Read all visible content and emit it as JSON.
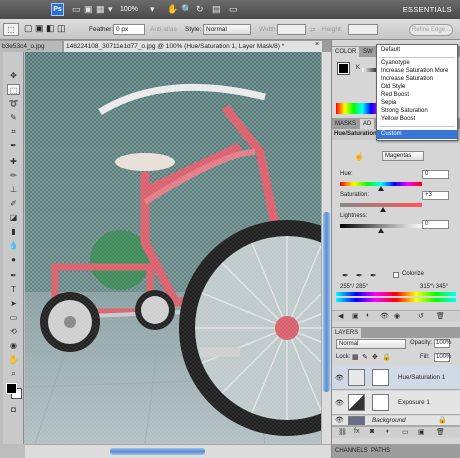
{
  "app_bar": {
    "logo": "Ps",
    "zoom": "100%",
    "workspace": "ESSENTIALS",
    "icons": [
      "bridge-icon",
      "mini-bridge-icon",
      "hand-icon",
      "zoom-icon",
      "rotate-view-icon",
      "arrange-documents-icon",
      "screen-mode-icon"
    ]
  },
  "options_bar": {
    "feather_label": "Feather:",
    "feather_value": "0 px",
    "anti_alias_label": "Anti-alias",
    "style_label": "Style:",
    "style_value": "Normal",
    "width_label": "Width:",
    "height_label": "Height:",
    "refine_edge": "Refine Edge..."
  },
  "document_tabs": [
    {
      "label": "b3e53c4_o.jpg"
    },
    {
      "label": "148224108_30711e1d77_o.jpg @ 100% (Hue/Saturation 1, Layer Mask/8) *"
    }
  ],
  "dock": {
    "top_tabs": [
      "COLOR",
      "SW"
    ],
    "color_k_label": "K",
    "mid_tabs": [
      "MASKS",
      "AD"
    ],
    "adjustment_title": "Hue/Saturation"
  },
  "preset_menu": {
    "items": [
      "Default",
      "Cyanotype",
      "Increase Saturation More",
      "Increase Saturation",
      "Old Style",
      "Red Boost",
      "Sepia",
      "Strong Saturation",
      "Yellow Boost",
      "Custom"
    ],
    "selected": "Custom"
  },
  "adjustments": {
    "channel": "Magentas",
    "hue_label": "Hue:",
    "hue_value": "0",
    "saturation_label": "Saturation:",
    "saturation_value": "+3",
    "lightness_label": "Lightness:",
    "lightness_value": "0",
    "colorize_label": "Colorize",
    "range_left": "255°/ 285°",
    "range_right": "315°\\ 345°"
  },
  "layers": {
    "tab_label": "LAYERS",
    "blend_mode": "Normal",
    "opacity_label": "Opacity:",
    "opacity_value": "100%",
    "lock_label": "Lock:",
    "fill_label": "Fill:",
    "fill_value": "100%",
    "items": [
      {
        "name": "Hue/Saturation 1",
        "visible": true,
        "selected": true
      },
      {
        "name": "Exposure 1",
        "visible": true,
        "selected": false
      },
      {
        "name": "Background",
        "visible": true,
        "selected": false,
        "locked": true
      }
    ],
    "bottom_tabs": [
      "CHANNELS",
      "PATHS"
    ]
  },
  "colors": {
    "selection_blue": "#3875d7",
    "logo_blue": "#2a6fd6",
    "foreground": "#000000",
    "background": "#ffffff"
  }
}
